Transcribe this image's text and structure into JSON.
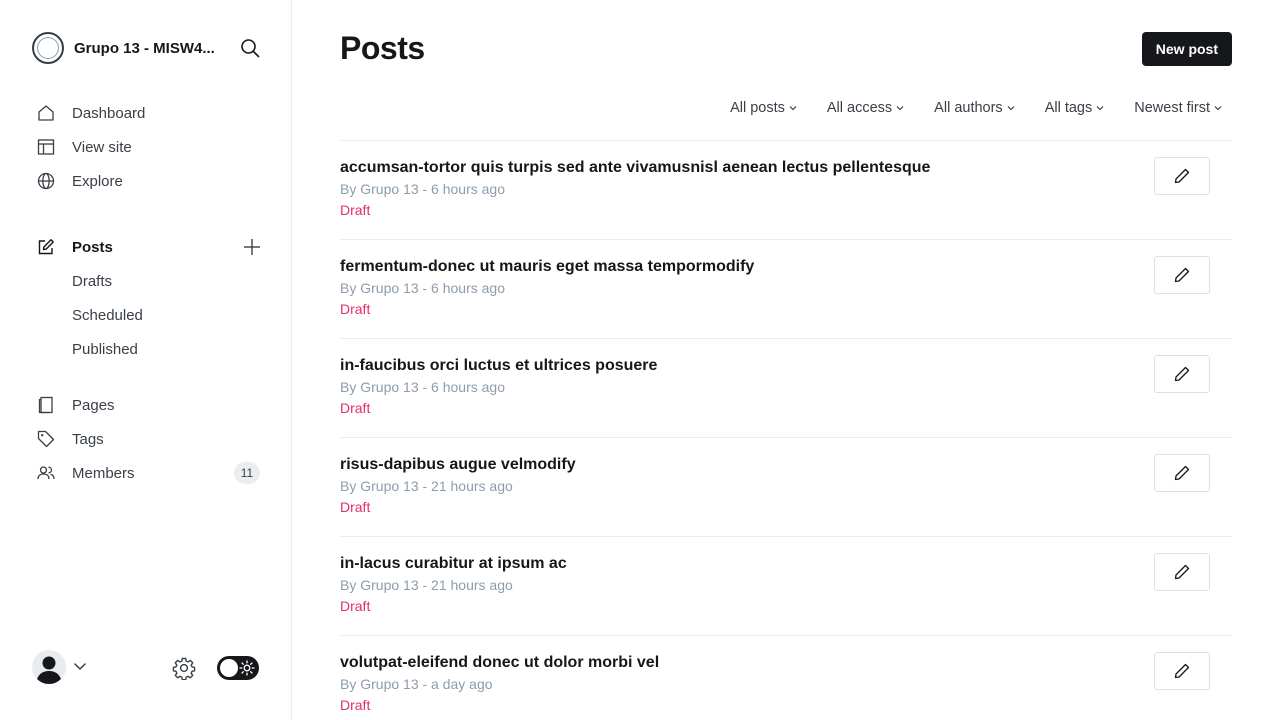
{
  "sidebar": {
    "site_title": "Grupo 13 - MISW4...",
    "nav_top": [
      {
        "label": "Dashboard",
        "icon": "home-icon"
      },
      {
        "label": "View site",
        "icon": "layout-icon"
      },
      {
        "label": "Explore",
        "icon": "globe-icon"
      }
    ],
    "posts": {
      "label": "Posts",
      "icon": "edit-icon"
    },
    "post_subitems": [
      "Drafts",
      "Scheduled",
      "Published"
    ],
    "nav_bottom": [
      {
        "label": "Pages",
        "icon": "page-icon"
      },
      {
        "label": "Tags",
        "icon": "tag-icon"
      },
      {
        "label": "Members",
        "icon": "members-icon",
        "badge": "11"
      }
    ]
  },
  "main": {
    "title": "Posts",
    "new_post_label": "New post",
    "filters": [
      "All posts",
      "All access",
      "All authors",
      "All tags",
      "Newest first"
    ],
    "posts": [
      {
        "title": "accumsan-tortor quis turpis sed ante vivamusnisl aenean lectus pellentesque",
        "meta": "By Grupo 13 - 6 hours ago",
        "status": "Draft"
      },
      {
        "title": "fermentum-donec ut mauris eget massa tempormodify",
        "meta": "By Grupo 13 - 6 hours ago",
        "status": "Draft"
      },
      {
        "title": "in-faucibus orci luctus et ultrices posuere",
        "meta": "By Grupo 13 - 6 hours ago",
        "status": "Draft"
      },
      {
        "title": "risus-dapibus augue velmodify",
        "meta": "By Grupo 13 - 21 hours ago",
        "status": "Draft"
      },
      {
        "title": "in-lacus curabitur at ipsum ac",
        "meta": "By Grupo 13 - 21 hours ago",
        "status": "Draft"
      },
      {
        "title": "volutpat-eleifend donec ut dolor morbi vel",
        "meta": "By Grupo 13 - a day ago",
        "status": "Draft"
      }
    ]
  },
  "colors": {
    "accent": "#15171a",
    "draft": "#e1306c",
    "muted": "#8e9cac",
    "border": "#ebeef0"
  }
}
